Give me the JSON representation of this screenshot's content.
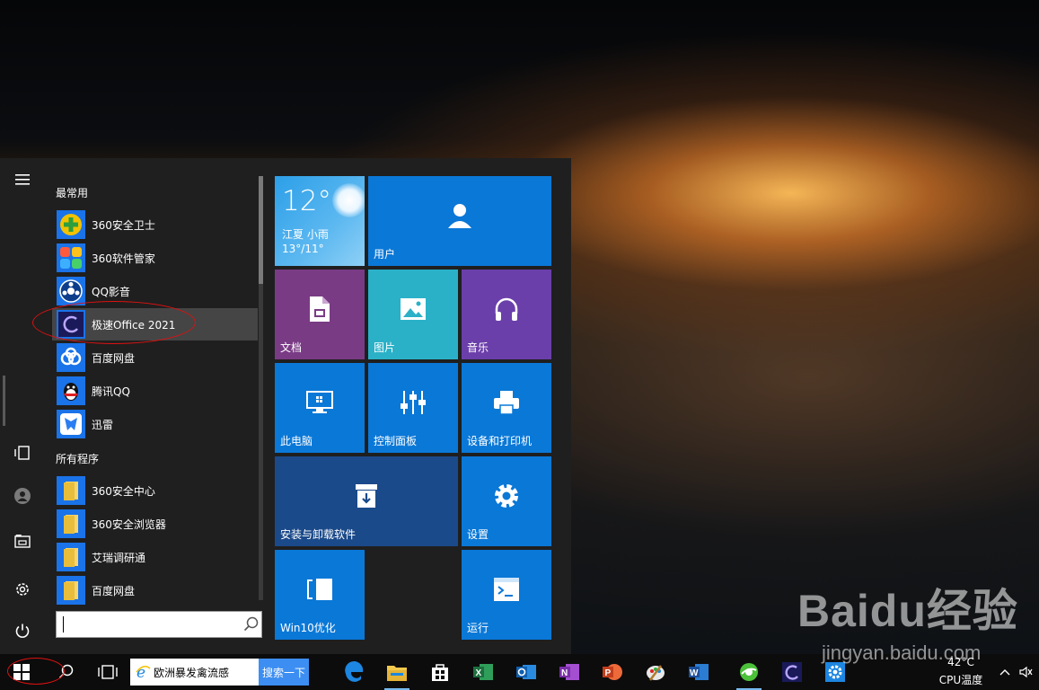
{
  "start_menu": {
    "sections": {
      "most_used": "最常用",
      "all_programs": "所有程序"
    },
    "most_used": [
      {
        "label": "360安全卫士",
        "icon": "360-safe-icon"
      },
      {
        "label": "360软件管家",
        "icon": "360-software-manager-icon"
      },
      {
        "label": "QQ影音",
        "icon": "qq-player-icon"
      },
      {
        "label": "极速Office 2021",
        "icon": "jisu-office-icon"
      },
      {
        "label": "百度网盘",
        "icon": "baidu-netdisk-icon"
      },
      {
        "label": "腾讯QQ",
        "icon": "qq-icon"
      },
      {
        "label": "迅雷",
        "icon": "xunlei-icon"
      }
    ],
    "all_programs": [
      {
        "label": "360安全中心",
        "icon": "folder-icon"
      },
      {
        "label": "360安全浏览器",
        "icon": "folder-icon"
      },
      {
        "label": "艾瑞调研通",
        "icon": "folder-icon"
      },
      {
        "label": "百度网盘",
        "icon": "folder-icon"
      }
    ],
    "rail": [
      "hamburger-icon",
      "tablet-mode-icon",
      "user-icon",
      "file-explorer-icon",
      "settings-icon",
      "power-icon"
    ]
  },
  "tiles": {
    "weather": {
      "temp": "12°",
      "location": "江夏 小雨",
      "range": "13°/11°"
    },
    "user": "用户",
    "documents": "文档",
    "pictures": "图片",
    "music": "音乐",
    "this_pc": "此电脑",
    "control_panel": "控制面板",
    "devices_printers": "设备和打印机",
    "install_uninstall": "安装与卸载软件",
    "settings": "设置",
    "win10_optimize": "Win10优化",
    "run": "运行"
  },
  "taskbar": {
    "search_text": "欧洲暴发禽流感",
    "search_button": "搜索一下",
    "cpu_temp": "42°C",
    "cpu_label": "CPU温度",
    "apps": [
      "edge-icon",
      "file-explorer-icon",
      "store-icon",
      "excel-icon",
      "outlook-icon",
      "onenote-icon",
      "powerpoint-icon",
      "paint-icon",
      "word-icon",
      "360-browser-icon",
      "jisu-office-icon",
      "settings-icon"
    ]
  },
  "watermark": {
    "logo": "Baidu经验",
    "url": "jingyan.baidu.com"
  },
  "colors": {
    "tile_blue": "#0a78d7",
    "tile_purple": "#7a3b85",
    "tile_teal": "#2ab1c8",
    "tile_violet": "#6b3faa",
    "tile_navy": "#1b4a8a",
    "start_bg": "#1f1f1f",
    "annotation_red": "#dd1111"
  }
}
